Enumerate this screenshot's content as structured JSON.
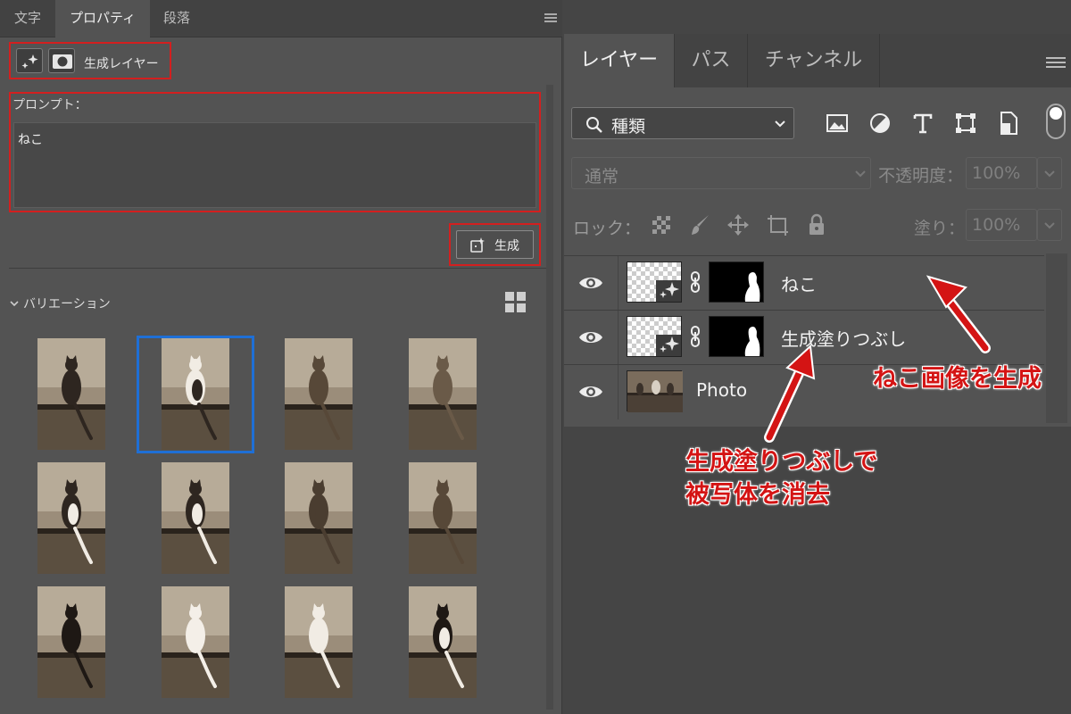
{
  "properties_panel": {
    "tabs": [
      {
        "label": "文字"
      },
      {
        "label": "プロパティ"
      },
      {
        "label": "段落"
      }
    ],
    "layer_type_label": "生成レイヤー",
    "prompt_label": "プロンプト：",
    "prompt_value": "ねこ",
    "generate_button": "生成",
    "variations_label": "バリエーション",
    "selected_variation": 2
  },
  "layers_panel": {
    "tabs": [
      {
        "label": "レイヤー"
      },
      {
        "label": "パス"
      },
      {
        "label": "チャンネル"
      }
    ],
    "filter_label": "種類",
    "blend_mode": "通常",
    "opacity_label": "不透明度：",
    "opacity_value": "100%",
    "lock_label": "ロック：",
    "fill_label": "塗り：",
    "fill_value": "100%",
    "layers": [
      {
        "name": "ねこ"
      },
      {
        "name": "生成塗りつぶし"
      },
      {
        "name": "Photo"
      }
    ]
  },
  "annotations": {
    "cat_generated": "ねこ画像を生成",
    "remove_line1": "生成塗りつぶしで",
    "remove_line2": "被写体を消去"
  },
  "colors": {
    "annotation": "#d41414",
    "selection": "#1e6fd6"
  }
}
